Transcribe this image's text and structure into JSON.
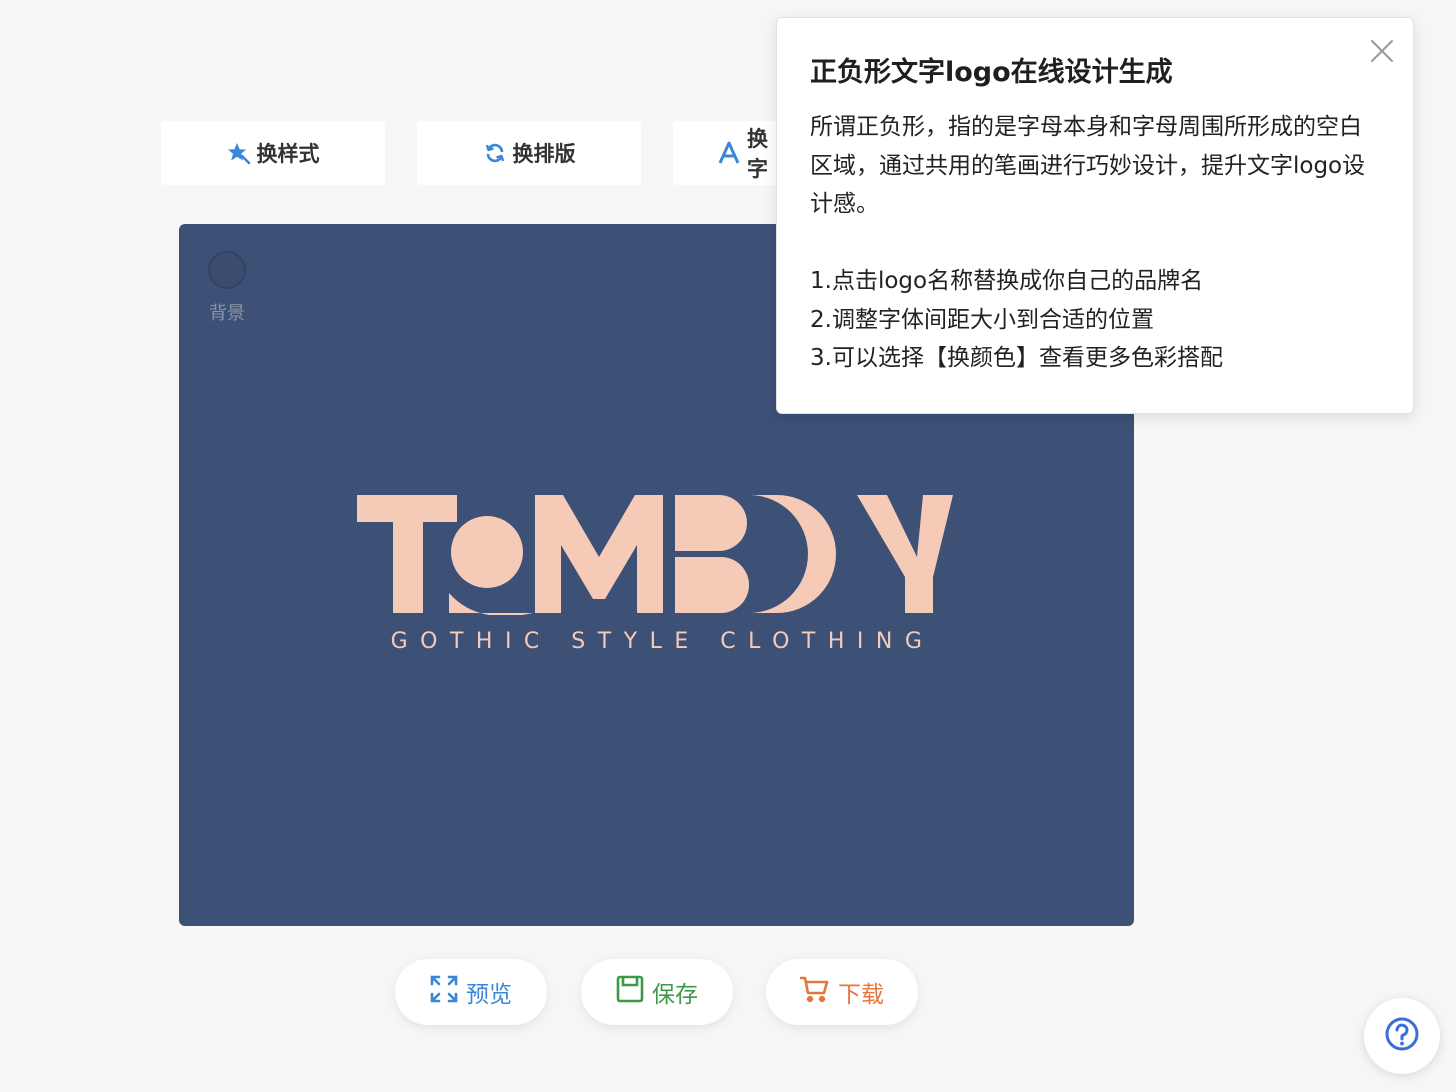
{
  "toolbar": {
    "style_label": "换样式",
    "layout_label": "换排版",
    "font_label": "换字"
  },
  "canvas": {
    "background_color": "#3d5076",
    "background_label": "背景",
    "logo_text": "TOMBOY",
    "logo_color": "#f5cbb8",
    "slogan": "GOTHIC STYLE CLOTHING"
  },
  "actions": {
    "preview_label": "预览",
    "save_label": "保存",
    "download_label": "下载"
  },
  "popover": {
    "title": "正负形文字logo在线设计生成",
    "description": "所谓正负形，指的是字母本身和字母周围所形成的空白区域，通过共用的笔画进行巧妙设计，提升文字logo设计感。",
    "steps": [
      "1.点击logo名称替换成你自己的品牌名",
      "2.调整字体间距大小到合适的位置",
      "3.可以选择【换颜色】查看更多色彩搭配"
    ]
  },
  "colors": {
    "accent_blue": "#3a86d8",
    "save_green": "#3c9a48",
    "download_orange": "#e5773a"
  }
}
